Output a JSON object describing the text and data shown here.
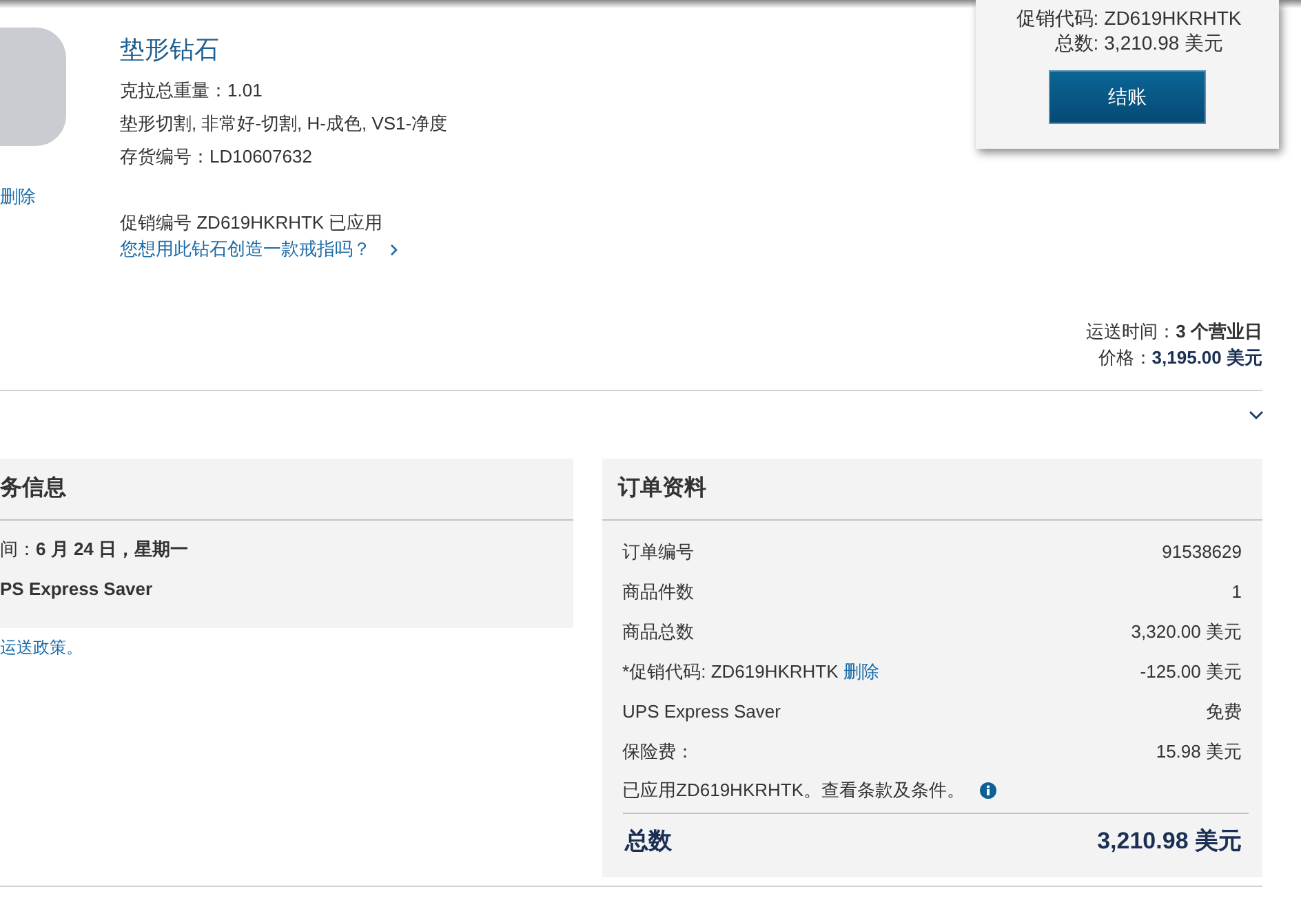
{
  "cart_popup": {
    "promo_label": "促销代码:",
    "promo_code": "ZD619HKRHTK",
    "total_label": "总数:",
    "total_value": "3,210.98 美元",
    "checkout_button": "结账"
  },
  "product": {
    "title": "垫形钻石",
    "carat": "克拉总重量：1.01",
    "specs": "垫形切割, 非常好-切割, H-成色, VS1-净度",
    "stock": "存货编号：LD10607632",
    "remove_link": "删除",
    "promo_note": "促销编号 ZD619HKRHTK 已应用",
    "ring_link": "您想用此钻石创造一款戒指吗？",
    "shipping_label": "运送时间：",
    "shipping_value": "3 个营业日",
    "price_label": "价格：",
    "price_value": "3,195.00 美元"
  },
  "shipping_panel": {
    "title": "务信息",
    "date_label": "间：",
    "date_value": "6 月 24 日，星期一",
    "method": "PS Express Saver",
    "policy_link": "运送政策。"
  },
  "order_panel": {
    "title": "订单资料",
    "rows": [
      {
        "kind": "plain",
        "label": "订单编号",
        "value": "91538629"
      },
      {
        "kind": "plain",
        "label": "商品件数",
        "value": "1"
      },
      {
        "kind": "plain",
        "label": "商品总数",
        "value": "3,320.00 美元"
      },
      {
        "kind": "promo",
        "label": "*促销代码: ZD619HKRHTK",
        "link": "删除",
        "value": "-125.00 美元"
      },
      {
        "kind": "plain",
        "label": "UPS Express Saver",
        "value": "免费"
      },
      {
        "kind": "plain",
        "label": "保险费：",
        "value": "15.98 美元"
      }
    ],
    "note": "已应用ZD619HKRHTK。查看条款及条件。",
    "total_label": "总数",
    "total_value": "3,210.98 美元"
  }
}
